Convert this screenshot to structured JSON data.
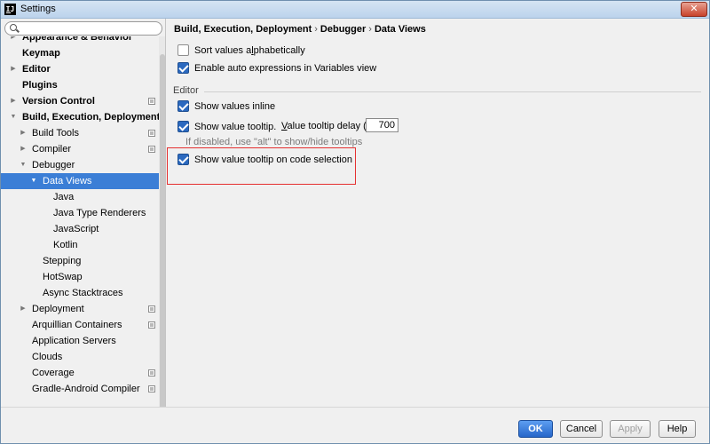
{
  "window": {
    "title": "Settings",
    "close_label": "✕"
  },
  "search": {
    "placeholder": "",
    "value": ""
  },
  "tree": [
    {
      "label": "Appearance & Behavior",
      "level": 0,
      "bold": true,
      "expandable": true,
      "expanded": false,
      "project": false,
      "selected": false
    },
    {
      "label": "Keymap",
      "level": 0,
      "bold": true,
      "expandable": false,
      "project": false,
      "selected": false
    },
    {
      "label": "Editor",
      "level": 0,
      "bold": true,
      "expandable": true,
      "expanded": false,
      "project": false,
      "selected": false
    },
    {
      "label": "Plugins",
      "level": 0,
      "bold": true,
      "expandable": false,
      "project": false,
      "selected": false
    },
    {
      "label": "Version Control",
      "level": 0,
      "bold": true,
      "expandable": true,
      "expanded": false,
      "project": true,
      "selected": false
    },
    {
      "label": "Build, Execution, Deployment",
      "level": 0,
      "bold": true,
      "expandable": true,
      "expanded": true,
      "project": false,
      "selected": false
    },
    {
      "label": "Build Tools",
      "level": 1,
      "bold": false,
      "expandable": true,
      "expanded": false,
      "project": true,
      "selected": false
    },
    {
      "label": "Compiler",
      "level": 1,
      "bold": false,
      "expandable": true,
      "expanded": false,
      "project": true,
      "selected": false
    },
    {
      "label": "Debugger",
      "level": 1,
      "bold": false,
      "expandable": true,
      "expanded": true,
      "project": false,
      "selected": false
    },
    {
      "label": "Data Views",
      "level": 2,
      "bold": false,
      "expandable": true,
      "expanded": true,
      "project": false,
      "selected": true
    },
    {
      "label": "Java",
      "level": 3,
      "bold": false,
      "expandable": false,
      "project": false,
      "selected": false
    },
    {
      "label": "Java Type Renderers",
      "level": 3,
      "bold": false,
      "expandable": false,
      "project": false,
      "selected": false
    },
    {
      "label": "JavaScript",
      "level": 3,
      "bold": false,
      "expandable": false,
      "project": false,
      "selected": false
    },
    {
      "label": "Kotlin",
      "level": 3,
      "bold": false,
      "expandable": false,
      "project": false,
      "selected": false
    },
    {
      "label": "Stepping",
      "level": 2,
      "bold": false,
      "expandable": false,
      "project": false,
      "selected": false
    },
    {
      "label": "HotSwap",
      "level": 2,
      "bold": false,
      "expandable": false,
      "project": false,
      "selected": false
    },
    {
      "label": "Async Stacktraces",
      "level": 2,
      "bold": false,
      "expandable": false,
      "project": false,
      "selected": false
    },
    {
      "label": "Deployment",
      "level": 1,
      "bold": false,
      "expandable": true,
      "expanded": false,
      "project": true,
      "selected": false
    },
    {
      "label": "Arquillian Containers",
      "level": 1,
      "bold": false,
      "expandable": false,
      "project": true,
      "selected": false
    },
    {
      "label": "Application Servers",
      "level": 1,
      "bold": false,
      "expandable": false,
      "project": false,
      "selected": false
    },
    {
      "label": "Clouds",
      "level": 1,
      "bold": false,
      "expandable": false,
      "project": false,
      "selected": false
    },
    {
      "label": "Coverage",
      "level": 1,
      "bold": false,
      "expandable": false,
      "project": true,
      "selected": false
    },
    {
      "label": "Gradle-Android Compiler",
      "level": 1,
      "bold": false,
      "expandable": false,
      "project": true,
      "selected": false
    }
  ],
  "breadcrumb": [
    "Build, Execution, Deployment",
    "Debugger",
    "Data Views"
  ],
  "options": {
    "sort_alpha": {
      "pre": "Sort values a",
      "mn": "l",
      "post": "phabetically",
      "checked": false
    },
    "auto_expr": {
      "label": "Enable auto expressions in Variables view",
      "checked": true
    }
  },
  "editor_section": {
    "title": "Editor",
    "show_inline": {
      "label": "Show values inline",
      "checked": true
    },
    "show_tooltip": {
      "label": "Show value tooltip.",
      "checked": true
    },
    "delay": {
      "mn": "V",
      "rest": "alue tooltip delay (ms):",
      "value": "700"
    },
    "hint": "If disabled, use \"alt\" to show/hide tooltips",
    "tooltip_on_selection": {
      "label": "Show value tooltip on code selection",
      "checked": true
    }
  },
  "footer": {
    "ok": "OK",
    "cancel": "Cancel",
    "apply": "Apply",
    "help": "Help"
  },
  "colors": {
    "selection": "#3b7ed6",
    "primary_button": "#2766c9",
    "highlight": "#e53030"
  }
}
